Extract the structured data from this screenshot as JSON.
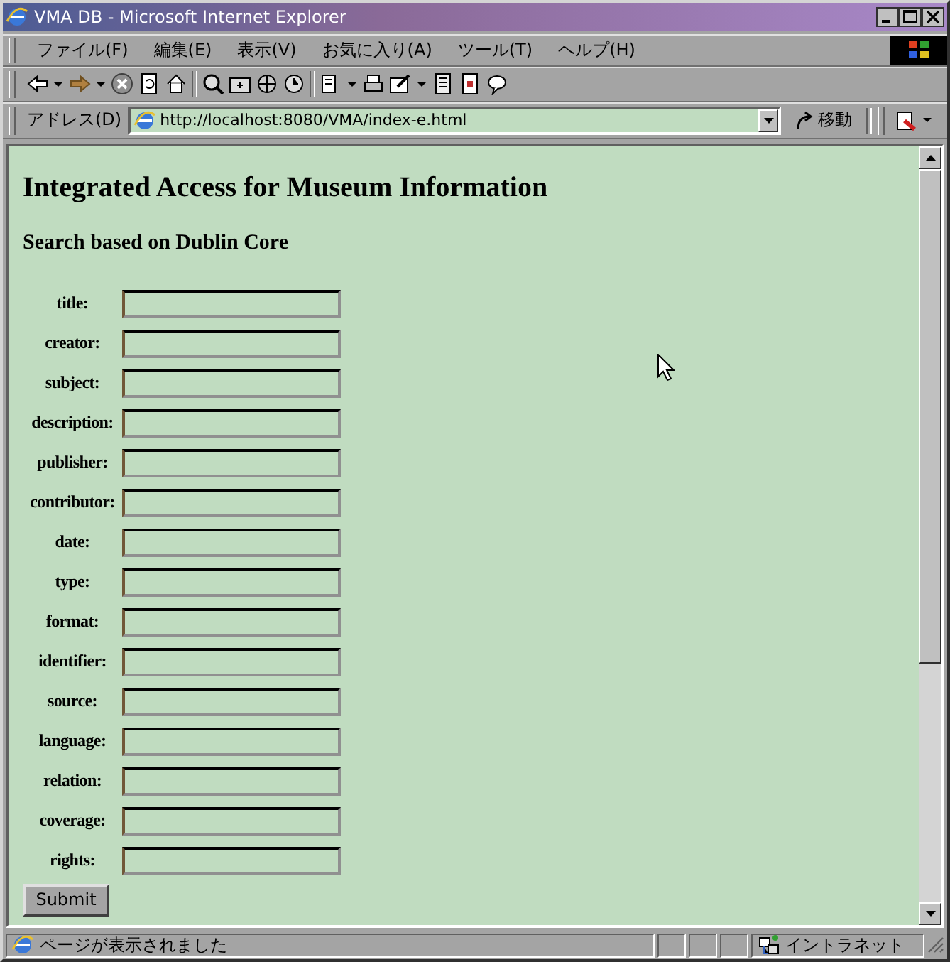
{
  "window": {
    "title": "VMA DB - Microsoft Internet Explorer"
  },
  "menu": [
    "ファイル(F)",
    "編集(E)",
    "表示(V)",
    "お気に入り(A)",
    "ツール(T)",
    "ヘルプ(H)"
  ],
  "address_bar": {
    "label": "アドレス(D)",
    "url": "http://localhost:8080/VMA/index-e.html",
    "go_button": "移動"
  },
  "page": {
    "heading": "Integrated Access for Museum Information",
    "subheading": "Search based on Dublin Core",
    "fields": [
      {
        "label": "title:"
      },
      {
        "label": "creator:"
      },
      {
        "label": "subject:"
      },
      {
        "label": "description:"
      },
      {
        "label": "publisher:"
      },
      {
        "label": "contributor:"
      },
      {
        "label": "date:"
      },
      {
        "label": "type:"
      },
      {
        "label": "format:"
      },
      {
        "label": "identifier:"
      },
      {
        "label": "source:"
      },
      {
        "label": "language:"
      },
      {
        "label": "relation:"
      },
      {
        "label": "coverage:"
      },
      {
        "label": "rights:"
      }
    ],
    "submit": "Submit"
  },
  "status_bar": {
    "message": "ページが表示されました",
    "zone": "イントラネット"
  }
}
